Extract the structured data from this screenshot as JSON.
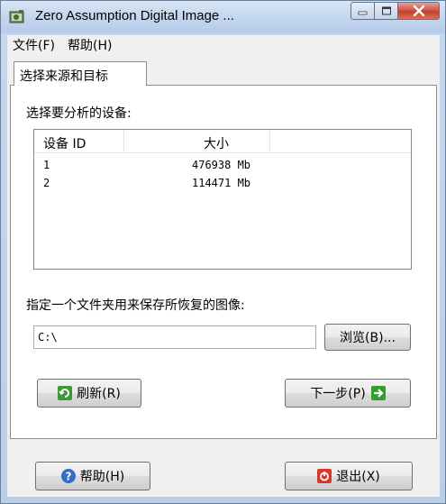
{
  "window": {
    "title": "Zero Assumption Digital Image ..."
  },
  "menu": {
    "file": "文件(F)",
    "help": "帮助(H)"
  },
  "tab": {
    "label": "选择来源和目标"
  },
  "device_section": {
    "label": "选择要分析的设备:",
    "columns": [
      "设备 ID",
      "大小"
    ],
    "rows": [
      {
        "id": "1",
        "size": "476938 Mb"
      },
      {
        "id": "2",
        "size": "114471 Mb"
      }
    ]
  },
  "folder_section": {
    "label": "指定一个文件夹用来保存所恢复的图像:",
    "path_value": "C:\\",
    "browse_label": "浏览(B)..."
  },
  "buttons": {
    "refresh_label": "刷新(R)",
    "next_label": "下一步(P)",
    "help_label": "帮助(H)",
    "exit_label": "退出(X)"
  },
  "colors": {
    "refresh_icon": "#3c9a36",
    "next_icon": "#2e9e2e",
    "help_icon": "#2f6fc9",
    "exit_icon": "#d63a2b"
  }
}
